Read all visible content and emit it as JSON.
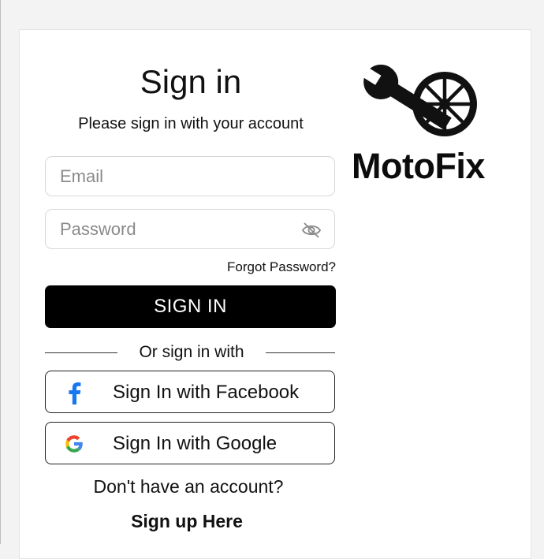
{
  "signin": {
    "title": "Sign in",
    "subtitle": "Please sign in with your account",
    "email_placeholder": "Email",
    "password_placeholder": "Password",
    "forgot_password": "Forgot Password?",
    "submit_label": "SIGN IN",
    "divider_text": "Or sign in with"
  },
  "social": {
    "facebook_label": "Sign In with Facebook",
    "google_label": "Sign In with Google",
    "facebook_icon": "facebook-icon",
    "google_icon": "google-icon"
  },
  "signup": {
    "prompt": "Don't have an account?",
    "link": "Sign up Here"
  },
  "brand": {
    "name": "MotoFix",
    "logo_icon": "wrench-wheel-icon"
  },
  "colors": {
    "primary": "#000000",
    "facebook": "#1877F2",
    "google_blue": "#4285F4",
    "google_red": "#EA4335",
    "google_yellow": "#FBBC05",
    "google_green": "#34A853"
  }
}
